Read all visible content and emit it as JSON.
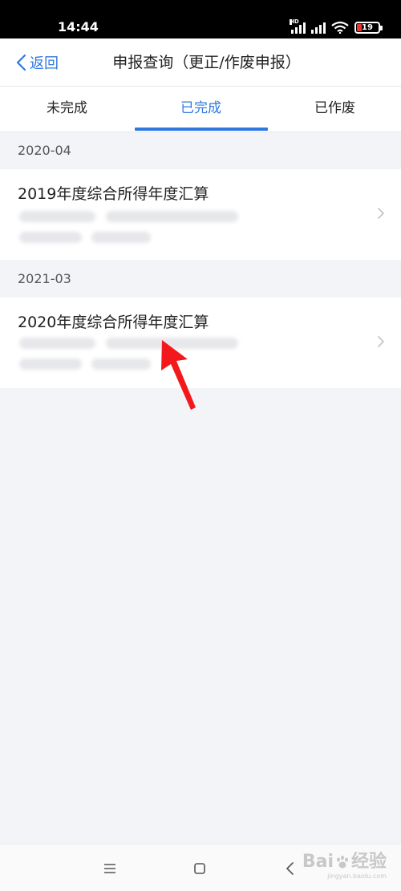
{
  "status_bar": {
    "time": "14:44",
    "hd_label": "HD",
    "battery_level": "19",
    "battery_color": "#e33333"
  },
  "nav": {
    "back_label": "返回",
    "title": "申报查询（更正/作废申报）",
    "accent_color": "#2f78e0"
  },
  "tabs": [
    {
      "label": "未完成",
      "active": false
    },
    {
      "label": "已完成",
      "active": true
    },
    {
      "label": "已作废",
      "active": false
    }
  ],
  "sections": [
    {
      "date": "2020-04",
      "items": [
        {
          "title": "2019年度综合所得年度汇算"
        }
      ]
    },
    {
      "date": "2021-03",
      "items": [
        {
          "title": "2020年度综合所得年度汇算"
        }
      ]
    }
  ],
  "icons": {
    "back": "chevron-left-icon",
    "item_arrow": "chevron-right-icon",
    "bottom_nav": [
      "menu-icon",
      "home-icon",
      "back-icon"
    ],
    "annotation": "red-arrow-icon"
  },
  "watermark": {
    "text_a": "Bai",
    "text_b": "经验",
    "sub": "jingyan.baidu.com"
  }
}
